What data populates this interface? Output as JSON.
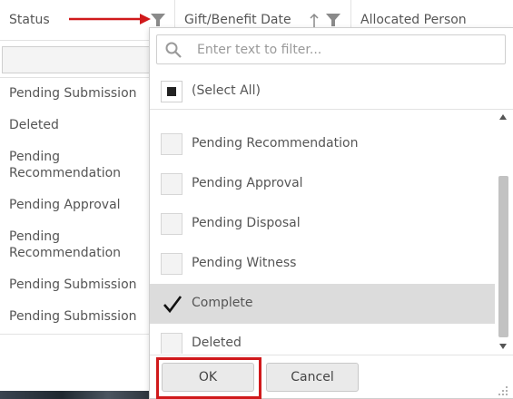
{
  "grid": {
    "columns": [
      "Status",
      "Gift/Benefit Date",
      "Allocated Person"
    ],
    "status_values": [
      "Pending Submission",
      "Deleted",
      "Pending Recommendation",
      "Pending Approval",
      "Pending Recommendation",
      "Pending Submission",
      "Pending Submission"
    ]
  },
  "filter_popup": {
    "search_placeholder": "Enter text to filter...",
    "select_all_label": "(Select All)",
    "select_all_state": "indeterminate",
    "options": [
      {
        "label": "Pending Recommendation",
        "checked": false
      },
      {
        "label": "Pending Approval",
        "checked": false
      },
      {
        "label": "Pending Disposal",
        "checked": false
      },
      {
        "label": "Pending Witness",
        "checked": false
      },
      {
        "label": "Complete",
        "checked": true
      },
      {
        "label": "Deleted",
        "checked": false
      }
    ],
    "ok_label": "OK",
    "cancel_label": "Cancel"
  },
  "colors": {
    "annotation": "#d0191b",
    "selected_row": "#dcdcdc"
  },
  "icons": {
    "filter": "funnel-icon",
    "sort": "sort-ascending-icon",
    "search": "search-icon",
    "check": "checkmark-icon"
  }
}
